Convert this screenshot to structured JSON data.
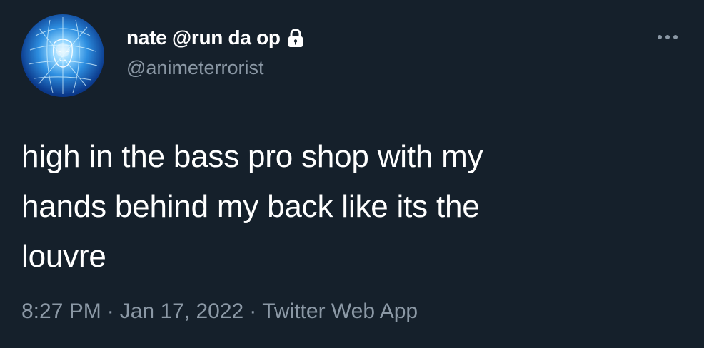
{
  "tweet": {
    "author": {
      "display_name": "nate @run da op",
      "handle": "@animeterrorist",
      "protected_icon": "lock-icon",
      "avatar_icon": "avatar-glowing-blue-face"
    },
    "text_lines": [
      "high in the bass pro shop with my",
      "hands behind my back like its the",
      "louvre"
    ],
    "meta": {
      "time": "8:27 PM",
      "separator": "·",
      "date": "Jan 17, 2022",
      "source": "Twitter Web App"
    },
    "more_icon": "more-horizontal-icon"
  },
  "colors": {
    "background": "#15202b",
    "primary_text": "#ffffff",
    "secondary_text": "#8b98a5"
  }
}
